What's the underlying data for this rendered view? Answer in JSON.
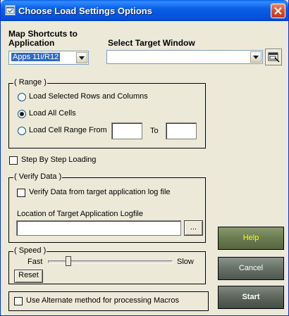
{
  "window": {
    "title": "Choose Load Settings Options"
  },
  "shortcuts": {
    "label": "Map Shortcuts to\nApplication",
    "label_line1": "Map Shortcuts to",
    "label_line2": "Application",
    "selected": "Apps 11i/R12"
  },
  "target": {
    "label": "Select Target Window",
    "selected": ""
  },
  "range": {
    "title": "( Range )",
    "options": [
      {
        "label": "Load Selected Rows and Columns",
        "checked": false
      },
      {
        "label": "Load All Cells",
        "checked": true
      },
      {
        "label": "Load Cell Range From",
        "checked": false
      }
    ],
    "from_value": "",
    "to_label": "To",
    "to_value": ""
  },
  "step_by_step": {
    "label": "Step By Step Loading",
    "checked": false
  },
  "verify": {
    "title": "( Verify Data )",
    "checkbox_label": "Verify Data from target application log file",
    "checked": false,
    "location_label": "Location of Target Application Logfile",
    "path_value": "",
    "browse_label": "..."
  },
  "speed": {
    "title": "( Speed )",
    "fast_label": "Fast",
    "slow_label": "Slow",
    "reset_label": "Reset",
    "level": 0.15
  },
  "alternate": {
    "label": "Use Alternate method for processing Macros",
    "checked": false
  },
  "buttons": {
    "help": "Help",
    "cancel": "Cancel",
    "start": "Start"
  },
  "colors": {
    "titlebar": "#0550d9",
    "dialog_bg": "#ece9d8",
    "help_text": "#ffff00",
    "selection": "#316ac5"
  },
  "icons": {
    "app": "app-window-icon",
    "close": "close-icon",
    "picker": "window-picker-icon",
    "dropdown": "chevron-down-icon"
  }
}
